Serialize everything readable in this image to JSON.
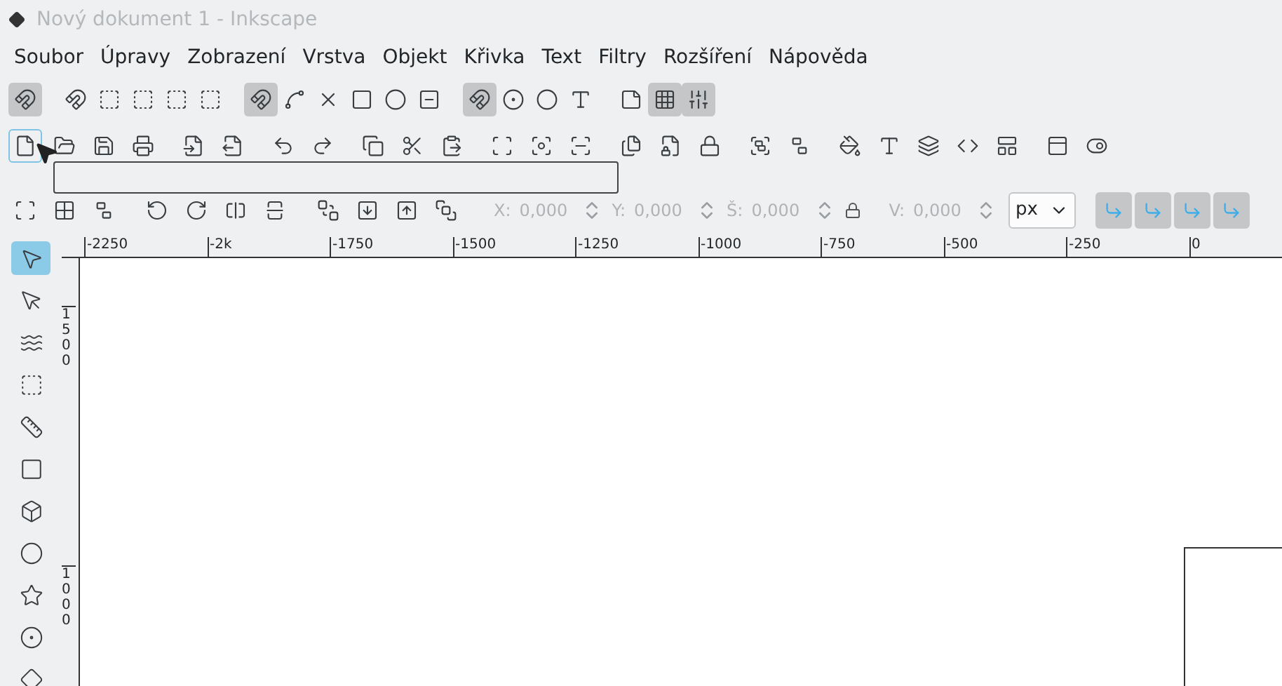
{
  "window": {
    "title": "Nový dokument 1 - Inkscape"
  },
  "menu": [
    "Soubor",
    "Úpravy",
    "Zobrazení",
    "Vrstva",
    "Objekt",
    "Křivka",
    "Text",
    "Filtry",
    "Rozšíření",
    "Nápověda"
  ],
  "snap_toolbar": [
    {
      "on": true
    },
    {
      "on": false
    },
    {
      "on": false
    },
    {
      "on": false
    },
    {
      "on": false
    },
    {
      "on": false
    },
    {
      "on": true
    },
    {
      "on": false
    },
    {
      "on": false
    },
    {
      "on": false
    },
    {
      "on": false
    },
    {
      "on": false
    },
    {
      "on": true
    },
    {
      "on": false
    },
    {
      "on": false
    },
    {
      "on": false
    },
    {
      "on": false
    },
    {
      "on": true
    },
    {
      "on": true
    }
  ],
  "command_toolbar": [
    {
      "focused": true
    },
    {
      "focused": false
    },
    {
      "focused": false
    },
    {
      "focused": false
    },
    {
      "focused": false
    },
    {
      "focused": false
    },
    {
      "focused": false
    },
    {
      "focused": false
    },
    {
      "focused": false
    },
    {
      "focused": false
    },
    {
      "focused": false
    },
    {
      "focused": false
    },
    {
      "focused": false
    },
    {
      "focused": false
    },
    {
      "focused": false
    },
    {
      "focused": false
    },
    {
      "focused": false
    },
    {
      "focused": false
    },
    {
      "focused": false
    },
    {
      "focused": false
    },
    {
      "focused": false
    },
    {
      "focused": false
    },
    {
      "focused": false
    },
    {
      "focused": false
    },
    {
      "focused": false
    },
    {
      "focused": false
    }
  ],
  "tool_controls": {
    "disabled": true,
    "fields": [
      {
        "label": "X:",
        "value": "0,000"
      },
      {
        "label": "Y:",
        "value": "0,000"
      },
      {
        "label": "Š:",
        "value": "0,000"
      },
      {
        "label": "V:",
        "value": "0,000"
      }
    ],
    "unit": "px",
    "toggles": [
      {
        "on": true
      },
      {
        "on": true
      },
      {
        "on": true
      },
      {
        "on": true
      }
    ]
  },
  "ruler": {
    "top_labels": [
      "-2250",
      "-2k",
      "-1750",
      "-1500",
      "-1250",
      "-1000",
      "-750",
      "-500",
      "-250",
      "0"
    ],
    "left_labels": [
      "1500",
      "1000"
    ]
  },
  "tools": [
    {
      "selected": true
    },
    {
      "selected": false
    },
    {
      "selected": false
    },
    {
      "selected": false
    },
    {
      "selected": false
    },
    {
      "selected": false
    },
    {
      "selected": false
    },
    {
      "selected": false
    },
    {
      "selected": false
    },
    {
      "selected": false
    },
    {
      "selected": false
    }
  ]
}
